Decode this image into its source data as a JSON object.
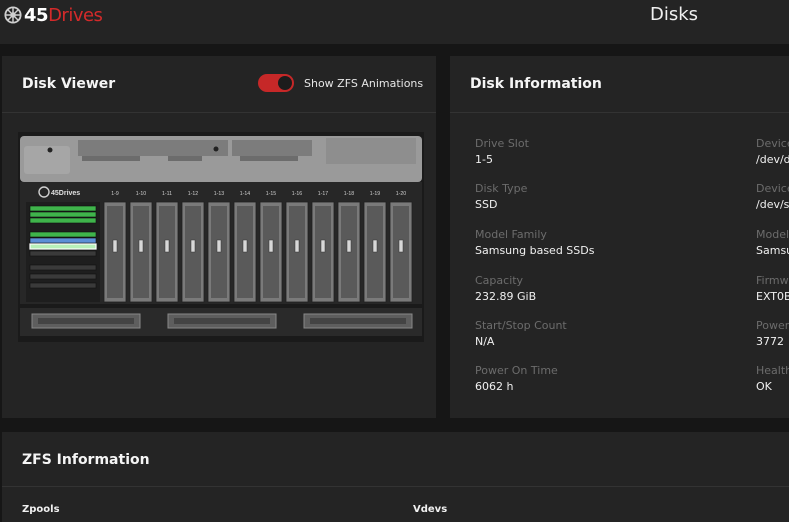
{
  "brand": {
    "number": "45",
    "word": "Drives"
  },
  "page_title": "Disks",
  "disk_viewer": {
    "title": "Disk Viewer",
    "toggle_label": "Show ZFS Animations",
    "toggle_on": true,
    "server_logo": "45Drives",
    "slot_labels": [
      "1-9",
      "1-10",
      "1-11",
      "1-12",
      "1-13",
      "1-14",
      "1-15",
      "1-16",
      "1-17",
      "1-18",
      "1-19",
      "1-20"
    ]
  },
  "disk_info": {
    "title": "Disk Information",
    "left": [
      {
        "label": "Drive Slot",
        "value": "1-5"
      },
      {
        "label": "Disk Type",
        "value": "SSD"
      },
      {
        "label": "Model Family",
        "value": "Samsung based SSDs"
      },
      {
        "label": "Capacity",
        "value": "232.89 GiB"
      },
      {
        "label": "Start/Stop Count",
        "value": "N/A"
      },
      {
        "label": "Power On Time",
        "value": "6062 h"
      }
    ],
    "right": [
      {
        "label": "Device",
        "value": "/dev/d"
      },
      {
        "label": "Device",
        "value": "/dev/s"
      },
      {
        "label": "Model",
        "value": "Samsu"
      },
      {
        "label": "Firmw",
        "value": "EXT0B"
      },
      {
        "label": "Power",
        "value": "3772"
      },
      {
        "label": "Health",
        "value": "OK"
      }
    ]
  },
  "zfs_info": {
    "title": "ZFS Information",
    "zpools_label": "Zpools",
    "vdevs_label": "Vdevs"
  },
  "colors": {
    "accent": "#d42a2a",
    "toggle": "#c62828",
    "drive_green": "#3fb44b"
  }
}
